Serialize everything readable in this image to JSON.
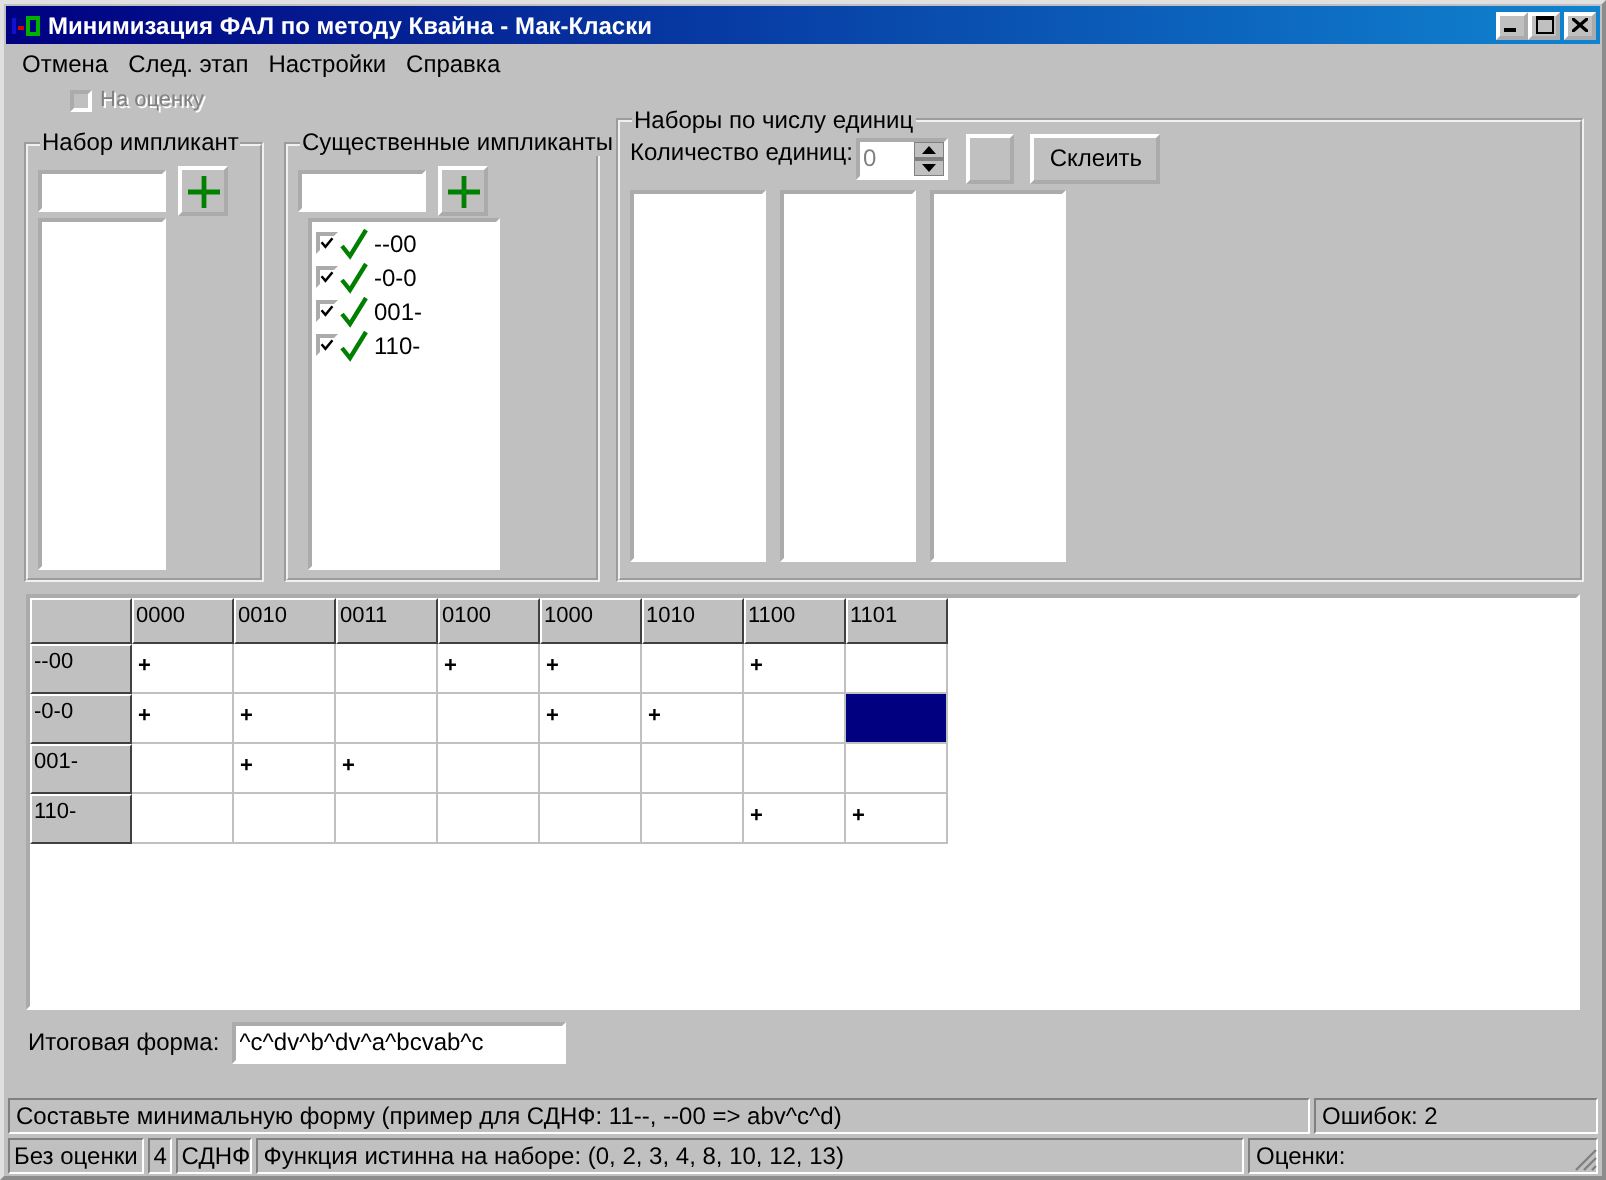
{
  "window": {
    "title": "Минимизация ФАЛ по методу Квайна - Мак-Класки"
  },
  "menu": [
    "Отмена",
    "След. этап",
    "Настройки",
    "Справка"
  ],
  "grade_checkbox": {
    "label": "На оценку",
    "checked": false,
    "disabled": true
  },
  "implicant_set": {
    "title": "Набор импликант"
  },
  "essential_implicants": {
    "title": "Существенные импликанты",
    "items": [
      {
        "label": "--00",
        "checked": true
      },
      {
        "label": "-0-0",
        "checked": true
      },
      {
        "label": "001-",
        "checked": true
      },
      {
        "label": "110-",
        "checked": true
      }
    ]
  },
  "sets_by_ones": {
    "title": "Наборы по числу единиц",
    "count_label": "Количество единиц:",
    "count_value": "0",
    "glue_button": "Склеить"
  },
  "table": {
    "columns": [
      "0000",
      "0010",
      "0011",
      "0100",
      "1000",
      "1010",
      "1100",
      "1101"
    ],
    "rows": [
      {
        "label": "--00",
        "cells": [
          {
            "text": "+",
            "selected": false
          },
          {
            "selected": false
          },
          {
            "selected": false
          },
          {
            "text": "+",
            "selected": false
          },
          {
            "text": "+",
            "selected": false
          },
          {
            "selected": false
          },
          {
            "text": "+",
            "selected": false
          },
          {
            "selected": false
          }
        ]
      },
      {
        "label": "-0-0",
        "cells": [
          {
            "text": "+",
            "selected": false
          },
          {
            "text": "+",
            "selected": false
          },
          {
            "selected": false
          },
          {
            "selected": false
          },
          {
            "text": "+",
            "selected": false
          },
          {
            "text": "+",
            "selected": false
          },
          {
            "selected": false
          },
          {
            "selected": true
          }
        ]
      },
      {
        "label": "001-",
        "cells": [
          {
            "selected": false
          },
          {
            "text": "+",
            "selected": false
          },
          {
            "text": "+",
            "selected": false
          },
          {
            "selected": false
          },
          {
            "selected": false
          },
          {
            "selected": false
          },
          {
            "selected": false
          },
          {
            "selected": false
          }
        ]
      },
      {
        "label": "110-",
        "cells": [
          {
            "selected": false
          },
          {
            "selected": false
          },
          {
            "selected": false
          },
          {
            "selected": false
          },
          {
            "selected": false
          },
          {
            "selected": false
          },
          {
            "text": "+",
            "selected": false
          },
          {
            "text": "+",
            "selected": false
          }
        ]
      }
    ]
  },
  "final_form": {
    "label": "Итоговая форма:",
    "value": "^c^dv^b^dv^a^bcvab^c"
  },
  "status_bar_1": [
    "Составьте минимальную форму (пример для СДНФ: 11--, --00 => abv^c^d)",
    "Ошибок: 2"
  ],
  "status_bar_2": [
    "Без оценки",
    "4",
    "СДНФ",
    "Функция истинна на наборе: (0, 2, 3, 4, 8, 10, 12, 13)",
    "Оценки:"
  ]
}
